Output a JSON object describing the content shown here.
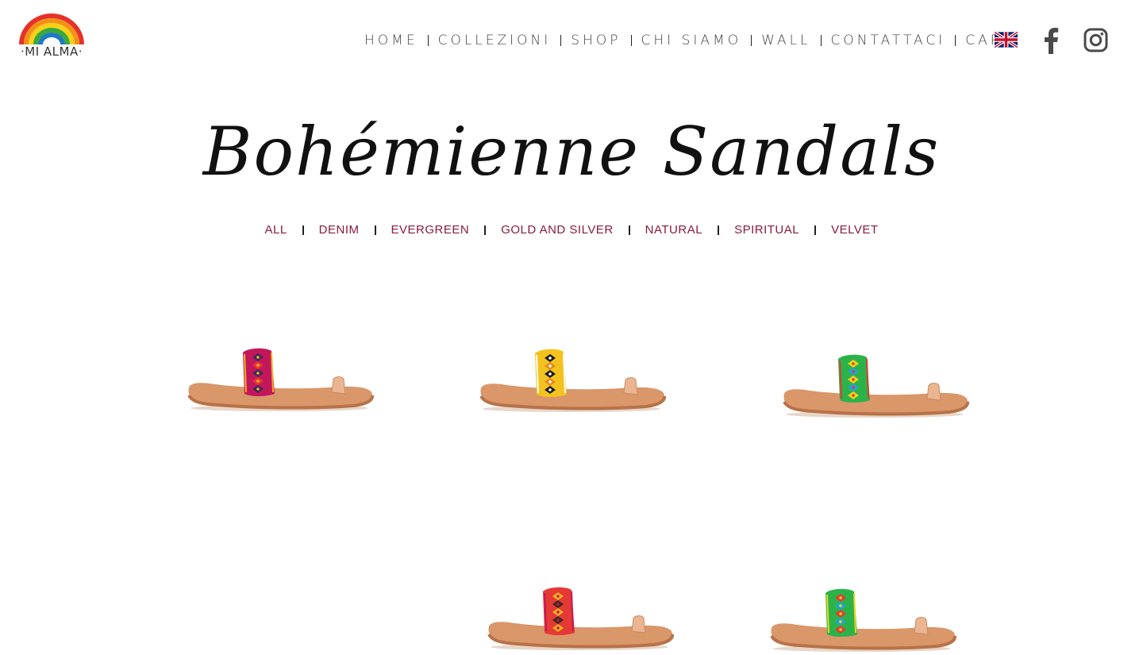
{
  "brand": {
    "logo_text": "·MI ALMA·",
    "rainbow_colors": [
      "#e4322b",
      "#f39019",
      "#f7d117",
      "#3aa93c",
      "#1f7ac0"
    ]
  },
  "nav": {
    "items": [
      "HOME",
      "COLLEZIONI",
      "SHOP",
      "CHI SIAMO",
      "WALL",
      "CONTATTACI",
      "CART"
    ],
    "language_icon": "uk-flag-icon",
    "social": [
      "facebook-icon",
      "instagram-icon"
    ]
  },
  "page": {
    "title": "Bohémienne Sandals"
  },
  "filters": {
    "items": [
      "ALL",
      "DENIM",
      "EVERGREEN",
      "GOLD AND SILVER",
      "NATURAL",
      "SPIRITUAL",
      "VELVET"
    ],
    "accent_color": "#8a1b3a"
  },
  "products": [
    {
      "strap_colors": [
        "#c2185b",
        "#3b2a5a",
        "#e53935",
        "#f2b01e"
      ]
    },
    {
      "strap_colors": [
        "#f4c21e",
        "#1a1a1a",
        "#e58a1c",
        "#ffffff"
      ]
    },
    {
      "strap_colors": [
        "#2bb34a",
        "#f2d21b",
        "#21a3d9",
        "#e53935"
      ]
    },
    {
      "strap_colors": [
        "#e53935",
        "#f2b01e",
        "#3b2a1a",
        "#c2185b"
      ]
    },
    {
      "strap_colors": [
        "#2bb34a",
        "#e53935",
        "#21a3d9",
        "#f2d21b"
      ]
    }
  ]
}
